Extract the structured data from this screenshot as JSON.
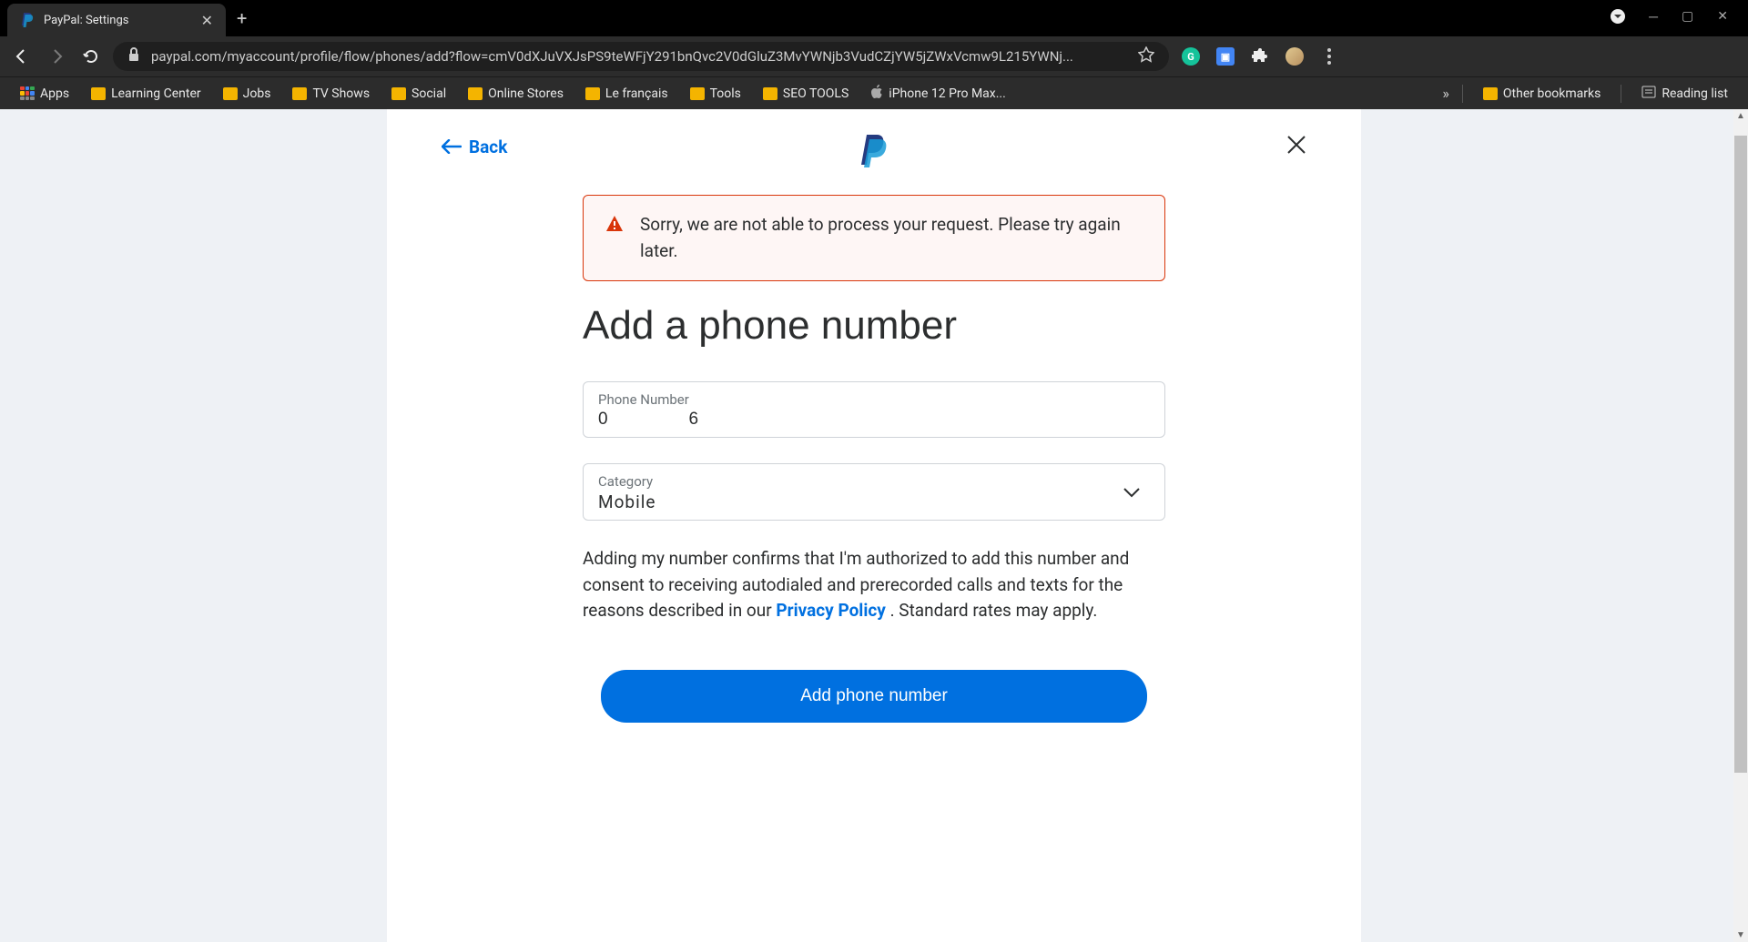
{
  "browser": {
    "tab_title": "PayPal: Settings",
    "url_display": "paypal.com/myaccount/profile/flow/phones/add?flow=cmV0dXJuVXJsPS9teWFjY291bnQvc2V0dGluZ3MvYWNjb3VudCZjYW5jZWxVcmw9L215YWNj...",
    "bookmarks": {
      "apps": "Apps",
      "learning": "Learning Center",
      "jobs": "Jobs",
      "tv": "TV Shows",
      "social": "Social",
      "stores": "Online Stores",
      "french": "Le français",
      "tools": "Tools",
      "seo": "SEO TOOLS",
      "iphone": "iPhone 12 Pro Max...",
      "other": "Other bookmarks",
      "reading": "Reading list"
    }
  },
  "page": {
    "back_label": "Back",
    "error_message": "Sorry, we are not able to process your request. Please try again later.",
    "heading": "Add a phone number",
    "phone_label": "Phone Number",
    "phone_value": "0              6",
    "category_label": "Category",
    "category_value": "Mobile",
    "disclaimer_part1": "Adding my number confirms that I'm authorized to add this number and consent to receiving autodialed and prerecorded calls and texts for the reasons described in our ",
    "privacy_link": "Privacy Policy",
    "disclaimer_part2": " . Standard rates may apply.",
    "submit_label": "Add phone number"
  }
}
